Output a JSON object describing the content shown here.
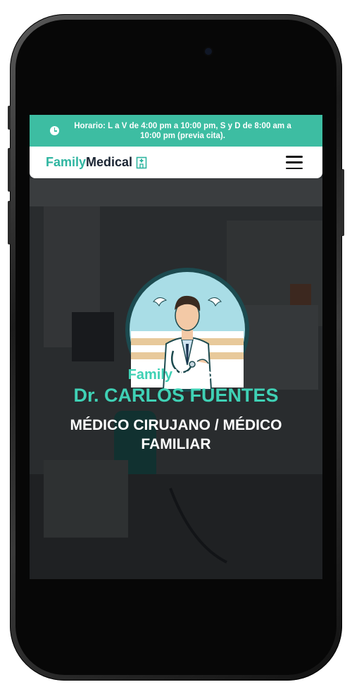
{
  "topbar": {
    "icon": "clock-icon",
    "schedule": "Horario: L a V de 4:00 pm a 10:00 pm, S y D de 8:00 am a 10:00 pm (previa cita)."
  },
  "navbar": {
    "logo_part1": "Family",
    "logo_part2": "Medical",
    "logo_icon": "hospital-icon",
    "menu_icon": "hamburger-menu-icon"
  },
  "hero": {
    "emblem_icon": "doctor-emblem-illustration",
    "brand_part1": "Family",
    "brand_part2": "Medical",
    "doctor_name": "Dr. CARLOS FUENTES",
    "specialty": "MÉDICO CIRUJANO / MÉDICO FAMILIAR"
  },
  "colors": {
    "accent": "#3dbda2",
    "accent_text": "#3fd1b5",
    "dark": "#1b2533"
  }
}
